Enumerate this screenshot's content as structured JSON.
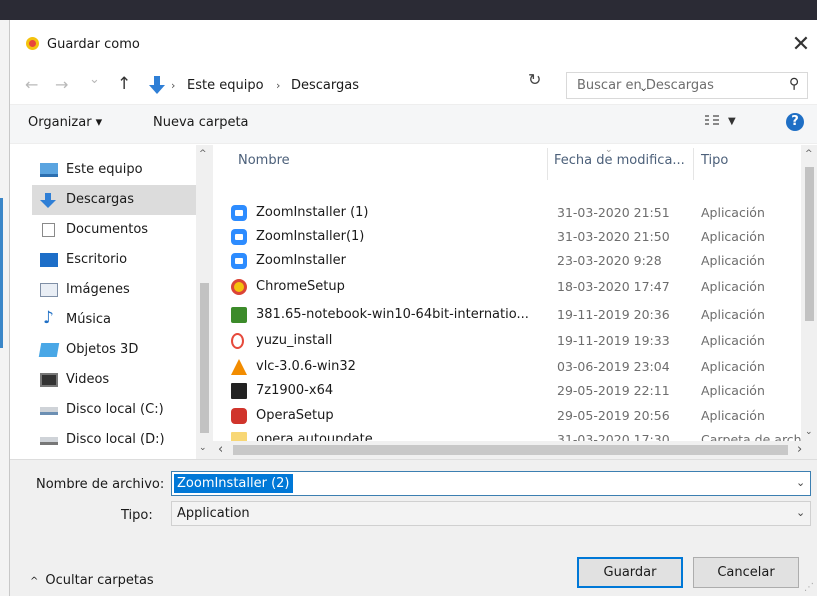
{
  "window": {
    "title": "Guardar como",
    "close_glyph": "✕"
  },
  "nav": {
    "back_glyph": "←",
    "forward_glyph": "→",
    "recent_glyph": "⌄",
    "up_glyph": "↑",
    "breadcrumb": [
      "Este equipo",
      "Descargas"
    ],
    "breadcrumb_separator": "›",
    "dropdown_glyph": "⌄",
    "refresh_glyph": "↻",
    "search_placeholder": "Buscar en Descargas",
    "search_glyph": "⚲"
  },
  "toolbar": {
    "organize_label": "Organizar ▾",
    "new_folder_label": "Nueva carpeta",
    "view_dropdown_glyph": "▼",
    "help_glyph": "?"
  },
  "sidebar": {
    "items": [
      {
        "label": "Este equipo",
        "icon": "monitor-icon"
      },
      {
        "label": "Descargas",
        "icon": "download-icon",
        "selected": true
      },
      {
        "label": "Documentos",
        "icon": "document-icon"
      },
      {
        "label": "Escritorio",
        "icon": "desktop-icon"
      },
      {
        "label": "Imágenes",
        "icon": "pictures-icon"
      },
      {
        "label": "Música",
        "icon": "music-icon"
      },
      {
        "label": "Objetos 3D",
        "icon": "3d-objects-icon"
      },
      {
        "label": "Videos",
        "icon": "videos-icon"
      },
      {
        "label": "Disco local (C:)",
        "icon": "drive-icon"
      },
      {
        "label": "Disco local (D:)",
        "icon": "drive-icon"
      }
    ],
    "scroll_up_glyph": "^",
    "scroll_down_glyph": "⌄"
  },
  "filelist": {
    "columns": [
      "Nombre",
      "Fecha de modifica...",
      "Tipo"
    ],
    "sort_glyph": "⌄",
    "files": [
      {
        "name": "ZoomInstaller (1)",
        "date": "31-03-2020 21:51",
        "type": "Aplicación",
        "icon": "zoom-icon"
      },
      {
        "name": "ZoomInstaller(1)",
        "date": "31-03-2020 21:50",
        "type": "Aplicación",
        "icon": "zoom-icon"
      },
      {
        "name": "ZoomInstaller",
        "date": "23-03-2020 9:28",
        "type": "Aplicación",
        "icon": "zoom-icon"
      },
      {
        "name": "ChromeSetup",
        "date": "18-03-2020 17:47",
        "type": "Aplicación",
        "icon": "chrome-icon"
      },
      {
        "name": "381.65-notebook-win10-64bit-internatio...",
        "date": "19-11-2019 20:36",
        "type": "Aplicación",
        "icon": "nvidia-icon"
      },
      {
        "name": "yuzu_install",
        "date": "19-11-2019 19:33",
        "type": "Aplicación",
        "icon": "yuzu-icon"
      },
      {
        "name": "vlc-3.0.6-win32",
        "date": "03-06-2019 23:04",
        "type": "Aplicación",
        "icon": "vlc-icon"
      },
      {
        "name": "7z1900-x64",
        "date": "29-05-2019 22:11",
        "type": "Aplicación",
        "icon": "7zip-icon"
      },
      {
        "name": "OperaSetup",
        "date": "29-05-2019 20:56",
        "type": "Aplicación",
        "icon": "opera-icon"
      },
      {
        "name": "opera autoupdate",
        "date": "31-03-2020 17:30",
        "type": "Carpeta de archiv",
        "icon": "folder-icon"
      }
    ],
    "scroll_up_glyph": "^",
    "scroll_down_glyph": "⌄",
    "scroll_left_glyph": "‹",
    "scroll_right_glyph": "›"
  },
  "form": {
    "filename_label": "Nombre de archivo:",
    "filename_value": "ZoomInstaller (2)",
    "type_label": "Tipo:",
    "type_value": "Application",
    "dropdown_glyph": "⌄",
    "hide_folders_label": "Ocultar carpetas",
    "hide_folders_glyph": "^",
    "save_label": "Guardar",
    "cancel_label": "Cancelar"
  }
}
